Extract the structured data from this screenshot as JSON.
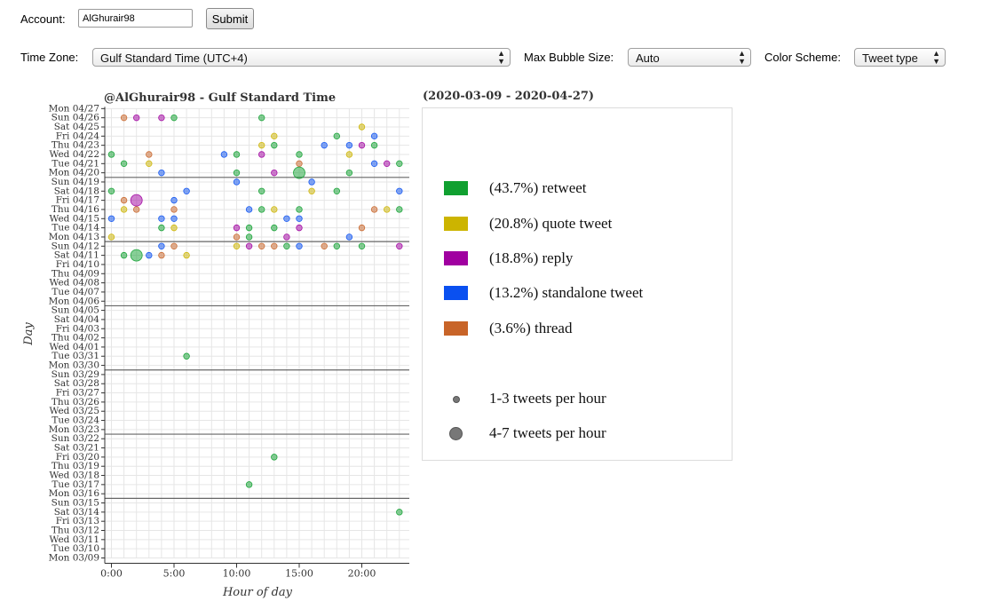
{
  "form": {
    "account_label": "Account:",
    "account_value": "AlGhurair98",
    "submit_label": "Submit",
    "timezone_label": "Time Zone:",
    "timezone_value": "Gulf Standard Time (UTC+4)",
    "bubble_label": "Max Bubble Size:",
    "bubble_value": "Auto",
    "scheme_label": "Color Scheme:",
    "scheme_value": "Tweet type"
  },
  "chart_title": "@AlGhurair98 - Gulf Standard Time",
  "date_range": "(2020-03-09 - 2020-04-27)",
  "legend": {
    "types": [
      {
        "label": "(43.7%) retweet",
        "color": "#10a030"
      },
      {
        "label": "(20.8%) quote tweet",
        "color": "#ccb400"
      },
      {
        "label": "(18.8%) reply",
        "color": "#a000a0"
      },
      {
        "label": "(13.2%) standalone tweet",
        "color": "#0a50f0"
      },
      {
        "label": "(3.6%) thread",
        "color": "#c86428"
      }
    ],
    "sizes": [
      {
        "label": "1-3 tweets per hour"
      },
      {
        "label": "4-7 tweets per hour"
      }
    ]
  },
  "chart_data": {
    "type": "scatter",
    "title": "@AlGhurair98 - Gulf Standard Time",
    "xlabel": "Hour of day",
    "ylabel": "Day",
    "xlim": [
      0,
      23
    ],
    "x_ticks": [
      "0:00",
      "5:00",
      "10:00",
      "15:00",
      "20:00"
    ],
    "x_tick_values": [
      0,
      5,
      10,
      15,
      20
    ],
    "days": [
      "Mon 03/09",
      "Tue 03/10",
      "Wed 03/11",
      "Thu 03/12",
      "Fri 03/13",
      "Sat 03/14",
      "Sun 03/15",
      "Mon 03/16",
      "Tue 03/17",
      "Wed 03/18",
      "Thu 03/19",
      "Fri 03/20",
      "Sat 03/21",
      "Sun 03/22",
      "Mon 03/23",
      "Tue 03/24",
      "Wed 03/25",
      "Thu 03/26",
      "Fri 03/27",
      "Sat 03/28",
      "Sun 03/29",
      "Mon 03/30",
      "Tue 03/31",
      "Wed 04/01",
      "Thu 04/02",
      "Fri 04/03",
      "Sat 04/04",
      "Sun 04/05",
      "Mon 04/06",
      "Tue 04/07",
      "Wed 04/08",
      "Thu 04/09",
      "Fri 04/10",
      "Sat 04/11",
      "Sun 04/12",
      "Mon 04/13",
      "Tue 04/14",
      "Wed 04/15",
      "Thu 04/16",
      "Fri 04/17",
      "Sat 04/18",
      "Sun 04/19",
      "Mon 04/20",
      "Tue 04/21",
      "Wed 04/22",
      "Thu 04/23",
      "Fri 04/24",
      "Sat 04/25",
      "Sun 04/26",
      "Mon 04/27"
    ],
    "week_separators_after": [
      "Sun 03/15",
      "Sun 03/22",
      "Sun 03/29",
      "Sun 04/05",
      "Sun 04/12",
      "Sun 04/19"
    ],
    "bubble_sizes": {
      "1-3 tweets per hour": 1,
      "4-7 tweets per hour": 2
    },
    "points": [
      {
        "day": "Sun 04/26",
        "hour": 1,
        "type": "thread"
      },
      {
        "day": "Sun 04/26",
        "hour": 2,
        "type": "reply"
      },
      {
        "day": "Sun 04/26",
        "hour": 4,
        "type": "reply"
      },
      {
        "day": "Sun 04/26",
        "hour": 5,
        "type": "retweet"
      },
      {
        "day": "Sun 04/26",
        "hour": 12,
        "type": "retweet"
      },
      {
        "day": "Sat 04/25",
        "hour": 20,
        "type": "quote tweet"
      },
      {
        "day": "Fri 04/24",
        "hour": 13,
        "type": "quote tweet"
      },
      {
        "day": "Fri 04/24",
        "hour": 18,
        "type": "retweet"
      },
      {
        "day": "Fri 04/24",
        "hour": 21,
        "type": "standalone tweet"
      },
      {
        "day": "Thu 04/23",
        "hour": 12,
        "type": "quote tweet"
      },
      {
        "day": "Thu 04/23",
        "hour": 13,
        "type": "retweet"
      },
      {
        "day": "Thu 04/23",
        "hour": 17,
        "type": "standalone tweet"
      },
      {
        "day": "Thu 04/23",
        "hour": 19,
        "type": "standalone tweet"
      },
      {
        "day": "Thu 04/23",
        "hour": 20,
        "type": "reply"
      },
      {
        "day": "Thu 04/23",
        "hour": 21,
        "type": "retweet"
      },
      {
        "day": "Wed 04/22",
        "hour": 0,
        "type": "retweet"
      },
      {
        "day": "Wed 04/22",
        "hour": 3,
        "type": "thread"
      },
      {
        "day": "Wed 04/22",
        "hour": 9,
        "type": "standalone tweet"
      },
      {
        "day": "Wed 04/22",
        "hour": 10,
        "type": "retweet"
      },
      {
        "day": "Wed 04/22",
        "hour": 12,
        "type": "reply"
      },
      {
        "day": "Wed 04/22",
        "hour": 15,
        "type": "retweet"
      },
      {
        "day": "Wed 04/22",
        "hour": 19,
        "type": "quote tweet"
      },
      {
        "day": "Tue 04/21",
        "hour": 1,
        "type": "retweet"
      },
      {
        "day": "Tue 04/21",
        "hour": 3,
        "type": "quote tweet"
      },
      {
        "day": "Tue 04/21",
        "hour": 15,
        "type": "thread"
      },
      {
        "day": "Tue 04/21",
        "hour": 21,
        "type": "standalone tweet"
      },
      {
        "day": "Tue 04/21",
        "hour": 22,
        "type": "reply"
      },
      {
        "day": "Tue 04/21",
        "hour": 23,
        "type": "retweet"
      },
      {
        "day": "Mon 04/20",
        "hour": 4,
        "type": "standalone tweet"
      },
      {
        "day": "Mon 04/20",
        "hour": 10,
        "type": "retweet"
      },
      {
        "day": "Mon 04/20",
        "hour": 13,
        "type": "reply"
      },
      {
        "day": "Mon 04/20",
        "hour": 15,
        "type": "retweet",
        "size": 2
      },
      {
        "day": "Mon 04/20",
        "hour": 19,
        "type": "retweet"
      },
      {
        "day": "Sun 04/19",
        "hour": 10,
        "type": "standalone tweet"
      },
      {
        "day": "Sun 04/19",
        "hour": 16,
        "type": "standalone tweet"
      },
      {
        "day": "Sat 04/18",
        "hour": 0,
        "type": "retweet"
      },
      {
        "day": "Sat 04/18",
        "hour": 6,
        "type": "standalone tweet"
      },
      {
        "day": "Sat 04/18",
        "hour": 12,
        "type": "retweet"
      },
      {
        "day": "Sat 04/18",
        "hour": 16,
        "type": "quote tweet"
      },
      {
        "day": "Sat 04/18",
        "hour": 18,
        "type": "retweet"
      },
      {
        "day": "Sat 04/18",
        "hour": 23,
        "type": "standalone tweet"
      },
      {
        "day": "Fri 04/17",
        "hour": 1,
        "type": "thread"
      },
      {
        "day": "Fri 04/17",
        "hour": 2,
        "type": "reply",
        "size": 2
      },
      {
        "day": "Fri 04/17",
        "hour": 5,
        "type": "standalone tweet"
      },
      {
        "day": "Thu 04/16",
        "hour": 1,
        "type": "quote tweet"
      },
      {
        "day": "Thu 04/16",
        "hour": 2,
        "type": "thread"
      },
      {
        "day": "Thu 04/16",
        "hour": 5,
        "type": "thread"
      },
      {
        "day": "Thu 04/16",
        "hour": 11,
        "type": "standalone tweet"
      },
      {
        "day": "Thu 04/16",
        "hour": 12,
        "type": "retweet"
      },
      {
        "day": "Thu 04/16",
        "hour": 13,
        "type": "quote tweet"
      },
      {
        "day": "Thu 04/16",
        "hour": 15,
        "type": "retweet"
      },
      {
        "day": "Thu 04/16",
        "hour": 21,
        "type": "thread"
      },
      {
        "day": "Thu 04/16",
        "hour": 22,
        "type": "quote tweet"
      },
      {
        "day": "Thu 04/16",
        "hour": 23,
        "type": "retweet"
      },
      {
        "day": "Wed 04/15",
        "hour": 0,
        "type": "standalone tweet"
      },
      {
        "day": "Wed 04/15",
        "hour": 4,
        "type": "standalone tweet"
      },
      {
        "day": "Wed 04/15",
        "hour": 5,
        "type": "standalone tweet"
      },
      {
        "day": "Wed 04/15",
        "hour": 14,
        "type": "standalone tweet"
      },
      {
        "day": "Wed 04/15",
        "hour": 15,
        "type": "standalone tweet"
      },
      {
        "day": "Tue 04/14",
        "hour": 4,
        "type": "retweet"
      },
      {
        "day": "Tue 04/14",
        "hour": 5,
        "type": "quote tweet"
      },
      {
        "day": "Tue 04/14",
        "hour": 10,
        "type": "reply"
      },
      {
        "day": "Tue 04/14",
        "hour": 11,
        "type": "retweet"
      },
      {
        "day": "Tue 04/14",
        "hour": 13,
        "type": "retweet"
      },
      {
        "day": "Tue 04/14",
        "hour": 15,
        "type": "reply"
      },
      {
        "day": "Tue 04/14",
        "hour": 20,
        "type": "thread"
      },
      {
        "day": "Mon 04/13",
        "hour": 0,
        "type": "quote tweet"
      },
      {
        "day": "Mon 04/13",
        "hour": 10,
        "type": "thread"
      },
      {
        "day": "Mon 04/13",
        "hour": 11,
        "type": "retweet"
      },
      {
        "day": "Mon 04/13",
        "hour": 14,
        "type": "reply"
      },
      {
        "day": "Mon 04/13",
        "hour": 19,
        "type": "standalone tweet"
      },
      {
        "day": "Sun 04/12",
        "hour": 4,
        "type": "standalone tweet"
      },
      {
        "day": "Sun 04/12",
        "hour": 5,
        "type": "thread"
      },
      {
        "day": "Sun 04/12",
        "hour": 10,
        "type": "quote tweet"
      },
      {
        "day": "Sun 04/12",
        "hour": 11,
        "type": "reply"
      },
      {
        "day": "Sun 04/12",
        "hour": 12,
        "type": "thread"
      },
      {
        "day": "Sun 04/12",
        "hour": 13,
        "type": "thread"
      },
      {
        "day": "Sun 04/12",
        "hour": 14,
        "type": "retweet"
      },
      {
        "day": "Sun 04/12",
        "hour": 15,
        "type": "standalone tweet"
      },
      {
        "day": "Sun 04/12",
        "hour": 17,
        "type": "thread"
      },
      {
        "day": "Sun 04/12",
        "hour": 18,
        "type": "retweet"
      },
      {
        "day": "Sun 04/12",
        "hour": 20,
        "type": "retweet"
      },
      {
        "day": "Sun 04/12",
        "hour": 23,
        "type": "reply"
      },
      {
        "day": "Sat 04/11",
        "hour": 1,
        "type": "retweet"
      },
      {
        "day": "Sat 04/11",
        "hour": 2,
        "type": "retweet",
        "size": 2
      },
      {
        "day": "Sat 04/11",
        "hour": 3,
        "type": "standalone tweet"
      },
      {
        "day": "Sat 04/11",
        "hour": 4,
        "type": "thread"
      },
      {
        "day": "Sat 04/11",
        "hour": 6,
        "type": "quote tweet"
      },
      {
        "day": "Tue 03/31",
        "hour": 6,
        "type": "retweet"
      },
      {
        "day": "Fri 03/20",
        "hour": 13,
        "type": "retweet"
      },
      {
        "day": "Tue 03/17",
        "hour": 11,
        "type": "retweet"
      },
      {
        "day": "Sat 03/14",
        "hour": 23,
        "type": "retweet"
      }
    ]
  }
}
